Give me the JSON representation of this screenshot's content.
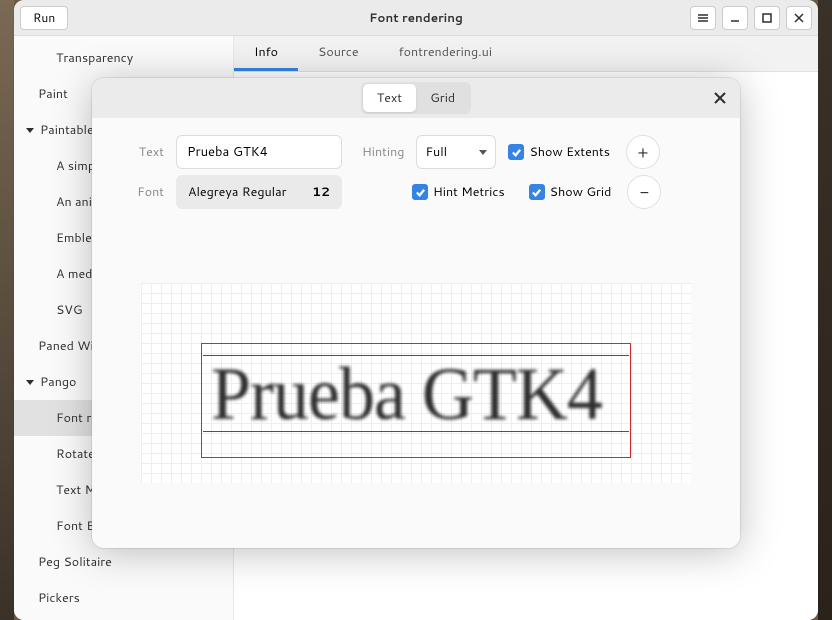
{
  "window": {
    "title": "Font rendering",
    "run": "Run"
  },
  "sidebar": {
    "items": [
      {
        "label": "Transparency",
        "cls": "sb-sub"
      },
      {
        "label": "Paint",
        "cls": ""
      },
      {
        "label": "Paintables",
        "cls": "expand"
      },
      {
        "label": "A simple...",
        "cls": "sb-sub"
      },
      {
        "label": "An anim...",
        "cls": "sb-sub"
      },
      {
        "label": "Emblem...",
        "cls": "sb-sub"
      },
      {
        "label": "A media...",
        "cls": "sb-sub"
      },
      {
        "label": "SVG",
        "cls": "sb-sub"
      },
      {
        "label": "Paned Widgets",
        "cls": ""
      },
      {
        "label": "Pango",
        "cls": "expand"
      },
      {
        "label": "Font re...",
        "cls": "sb-sub active"
      },
      {
        "label": "Rotate...",
        "cls": "sb-sub"
      },
      {
        "label": "Text M...",
        "cls": "sb-sub"
      },
      {
        "label": "Font E...",
        "cls": "sb-sub"
      },
      {
        "label": "Peg Solitaire",
        "cls": ""
      },
      {
        "label": "Pickers",
        "cls": ""
      }
    ]
  },
  "tabs": {
    "info": "Info",
    "source": "Source",
    "ui": "fontrendering.ui"
  },
  "dialog": {
    "view_text": "Text",
    "view_grid": "Grid",
    "text_label": "Text",
    "text_value": "Prueba GTK4",
    "font_label": "Font",
    "font_name": "Alegreya Regular",
    "font_size": "12",
    "hinting_label": "Hinting",
    "hinting_value": "Full",
    "show_extents": "Show Extents",
    "hint_metrics": "Hint Metrics",
    "show_grid": "Show Grid",
    "render_text": "Prueba GTK4"
  }
}
